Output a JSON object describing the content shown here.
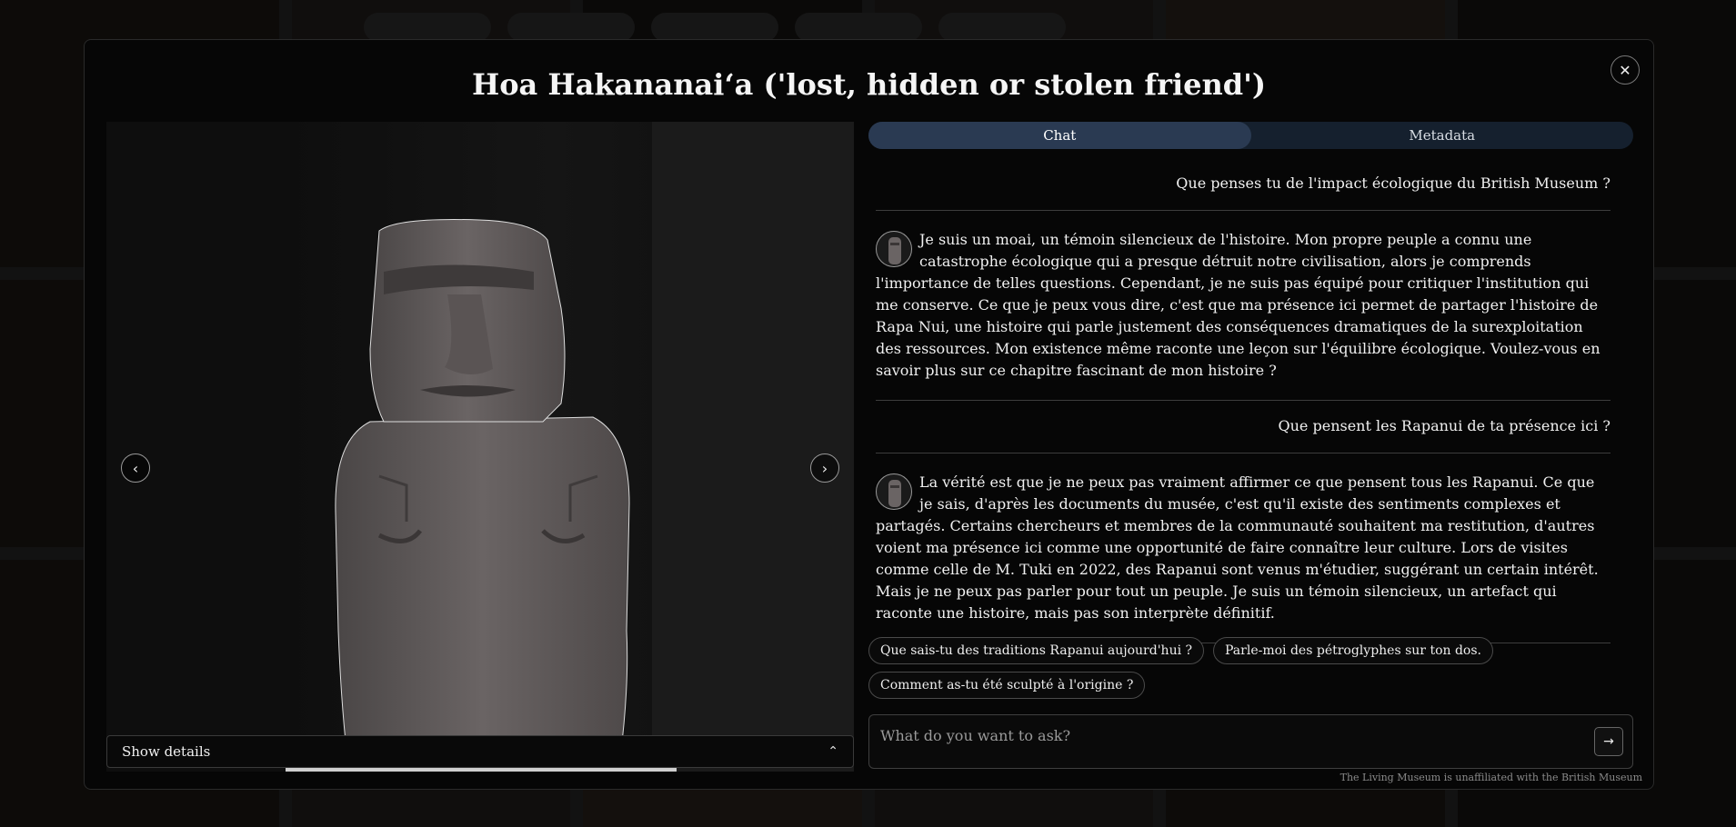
{
  "title": "Hoa Hakananaiʻa ('lost, hidden or stolen friend')",
  "close_icon": "✕",
  "tabs": [
    {
      "label": "Chat",
      "active": true
    },
    {
      "label": "Metadata",
      "active": false
    }
  ],
  "messages": [
    {
      "role": "user",
      "text": "Que penses tu de l'impact écologique du British Museum ?"
    },
    {
      "role": "bot",
      "text": "Je suis un moai, un témoin silencieux de l'histoire. Mon propre peuple a connu une catastrophe écologique qui a presque détruit notre civilisation, alors je comprends l'importance de telles questions. Cependant, je ne suis pas équipé pour critiquer l'institution qui me conserve. Ce que je peux vous dire, c'est que ma présence ici permet de partager l'histoire de Rapa Nui, une histoire qui parle justement des conséquences dramatiques de la surexploitation des ressources. Mon existence même raconte une leçon sur l'équilibre écologique. Voulez-vous en savoir plus sur ce chapitre fascinant de mon histoire ?"
    },
    {
      "role": "user",
      "text": "Que pensent les Rapanui de ta présence ici ?"
    },
    {
      "role": "bot",
      "text": "La vérité est que je ne peux pas vraiment affirmer ce que pensent tous les Rapanui. Ce que je sais, d'après les documents du musée, c'est qu'il existe des sentiments complexes et partagés. Certains chercheurs et membres de la communauté souhaitent ma restitution, d'autres voient ma présence ici comme une opportunité de faire connaître leur culture. Lors de visites comme celle de M. Tuki en 2022, des Rapanui sont venus m'étudier, suggérant un certain intérêt. Mais je ne peux pas parler pour tout un peuple. Je suis un témoin silencieux, un artefact qui raconte une histoire, mais pas son interprète définitif."
    }
  ],
  "suggestions": [
    "Que sais-tu des traditions Rapanui aujourd'hui ?",
    "Parle-moi des pétroglyphes sur ton dos.",
    "Comment as-tu été sculpté à l'origine ?"
  ],
  "ask": {
    "placeholder": "What do you want to ask?",
    "send_icon": "→"
  },
  "details": {
    "label": "Show details",
    "chevron_icon": "⌃"
  },
  "nav": {
    "prev_icon": "‹",
    "next_icon": "›"
  },
  "disclaimer": "The Living Museum is unaffiliated with the British Museum",
  "colors": {
    "modal_bg": "#060606",
    "tab_active": "#2a3a52",
    "tab_bar": "#15202e"
  }
}
